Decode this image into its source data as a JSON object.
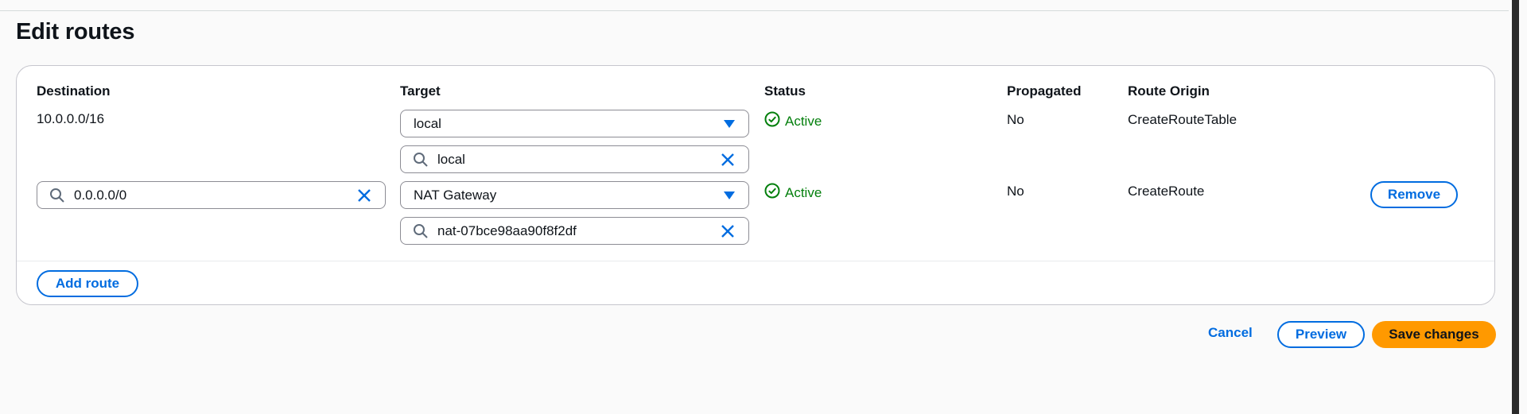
{
  "page": {
    "title": "Edit routes"
  },
  "columns": {
    "destination": "Destination",
    "target": "Target",
    "status": "Status",
    "propagated": "Propagated",
    "route_origin": "Route Origin"
  },
  "routes": [
    {
      "destination_text": "10.0.0.0/16",
      "target_type": "local",
      "target_search_value": "local",
      "status": "Active",
      "propagated": "No",
      "route_origin": "CreateRouteTable"
    },
    {
      "destination_search_value": "0.0.0.0/0",
      "target_type": "NAT Gateway",
      "target_search_value": "nat-07bce98aa90f8f2df",
      "status": "Active",
      "propagated": "No",
      "route_origin": "CreateRoute",
      "remove_label": "Remove"
    }
  ],
  "actions": {
    "add_route": "Add route",
    "cancel": "Cancel",
    "preview": "Preview",
    "save": "Save changes"
  },
  "icons": {
    "search": "search-icon",
    "clear": "close-icon",
    "caret": "caret-down-icon",
    "status_ok": "status-positive-icon"
  },
  "colors": {
    "link": "#006ce0",
    "primary": "#ff9900",
    "success": "#037f0c",
    "border": "#8c8c94"
  }
}
